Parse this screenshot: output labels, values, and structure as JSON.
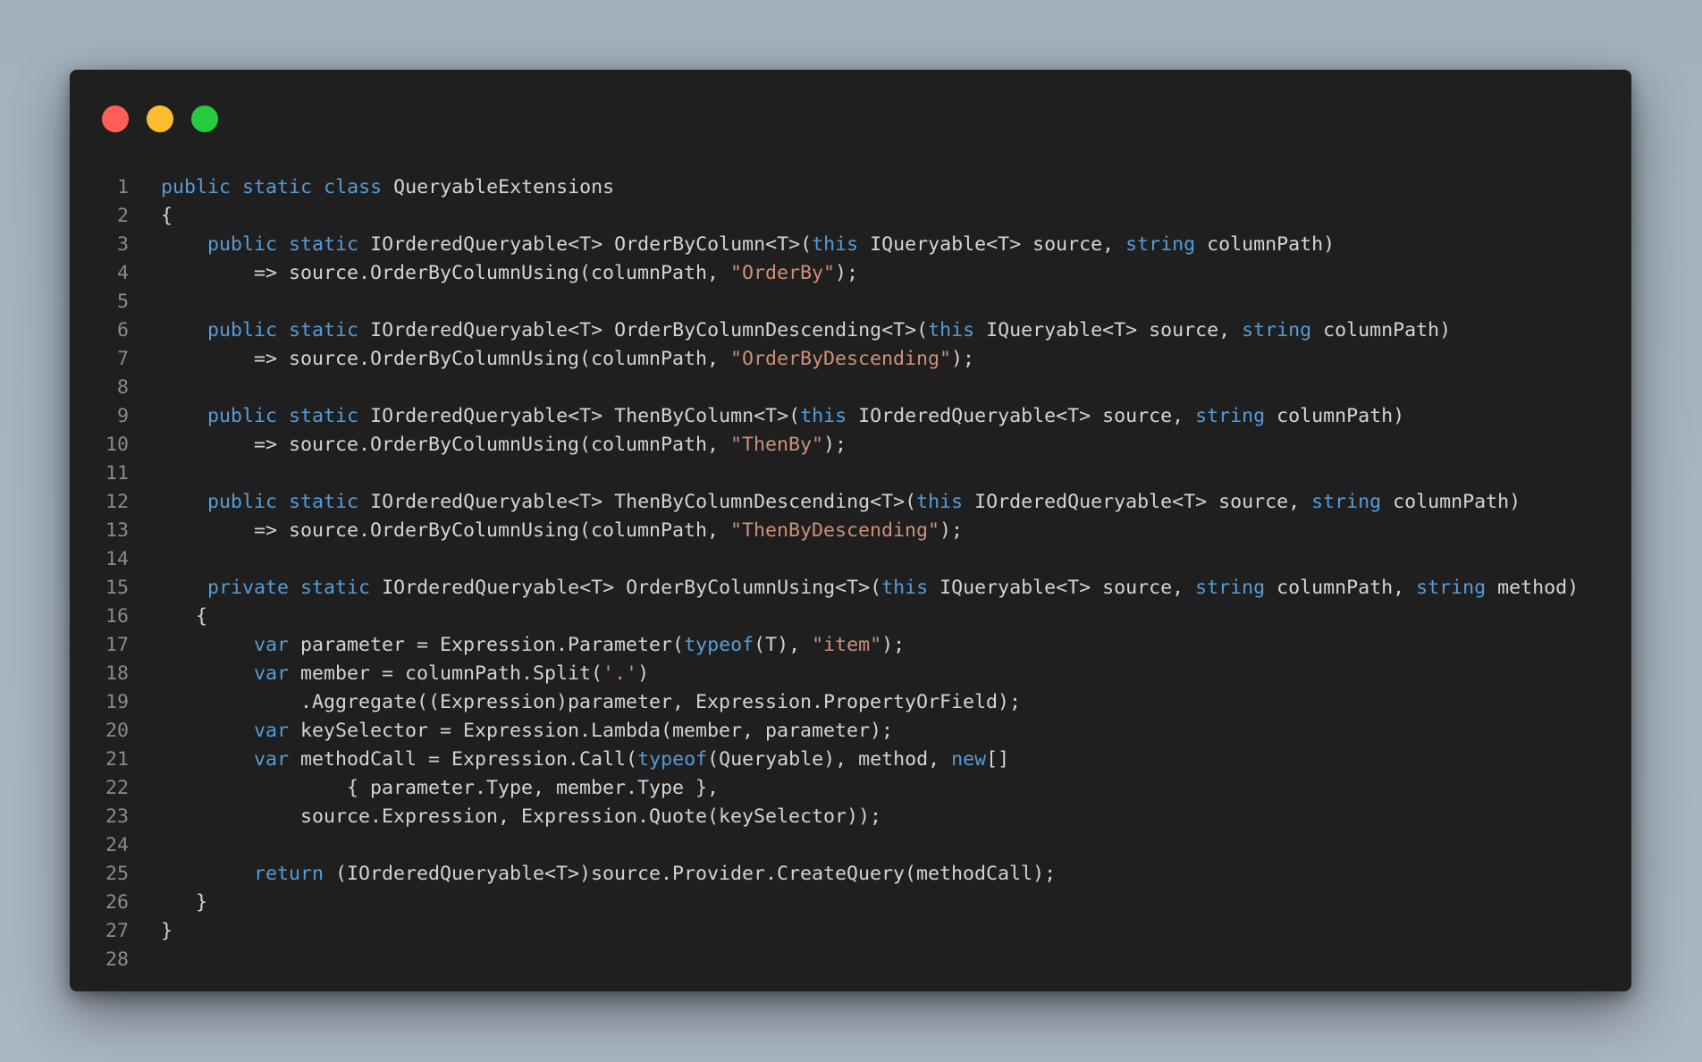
{
  "window": {
    "title_buttons": [
      "close",
      "minimize",
      "maximize"
    ],
    "colors": {
      "background": "#1f1f1f",
      "close": "#ff5f56",
      "minimize": "#ffbd2e",
      "maximize": "#27c93f",
      "keyword": "#569cd6",
      "string": "#ce9178",
      "text": "#d4d4d4",
      "line_number": "#8a8a8a"
    }
  },
  "code": {
    "language": "csharp",
    "lines": [
      {
        "n": "1",
        "tokens": [
          [
            "kw",
            "public"
          ],
          [
            "p",
            " "
          ],
          [
            "kw",
            "static"
          ],
          [
            "p",
            " "
          ],
          [
            "kw",
            "class"
          ],
          [
            "p",
            " QueryableExtensions"
          ]
        ]
      },
      {
        "n": "2",
        "tokens": [
          [
            "p",
            "{"
          ]
        ]
      },
      {
        "n": "3",
        "tokens": [
          [
            "p",
            "    "
          ],
          [
            "kw",
            "public"
          ],
          [
            "p",
            " "
          ],
          [
            "kw",
            "static"
          ],
          [
            "p",
            " IOrderedQueryable<T> OrderByColumn<T>("
          ],
          [
            "kw",
            "this"
          ],
          [
            "p",
            " IQueryable<T> source, "
          ],
          [
            "kw",
            "string"
          ],
          [
            "p",
            " columnPath)"
          ]
        ]
      },
      {
        "n": "4",
        "tokens": [
          [
            "p",
            "        => source.OrderByColumnUsing(columnPath, "
          ],
          [
            "str",
            "\"OrderBy\""
          ],
          [
            "p",
            ");"
          ]
        ]
      },
      {
        "n": "5",
        "tokens": []
      },
      {
        "n": "6",
        "tokens": [
          [
            "p",
            "    "
          ],
          [
            "kw",
            "public"
          ],
          [
            "p",
            " "
          ],
          [
            "kw",
            "static"
          ],
          [
            "p",
            " IOrderedQueryable<T> OrderByColumnDescending<T>("
          ],
          [
            "kw",
            "this"
          ],
          [
            "p",
            " IQueryable<T> source, "
          ],
          [
            "kw",
            "string"
          ],
          [
            "p",
            " columnPath)"
          ]
        ]
      },
      {
        "n": "7",
        "tokens": [
          [
            "p",
            "        => source.OrderByColumnUsing(columnPath, "
          ],
          [
            "str",
            "\"OrderByDescending\""
          ],
          [
            "p",
            ");"
          ]
        ]
      },
      {
        "n": "8",
        "tokens": []
      },
      {
        "n": "9",
        "tokens": [
          [
            "p",
            "    "
          ],
          [
            "kw",
            "public"
          ],
          [
            "p",
            " "
          ],
          [
            "kw",
            "static"
          ],
          [
            "p",
            " IOrderedQueryable<T> ThenByColumn<T>("
          ],
          [
            "kw",
            "this"
          ],
          [
            "p",
            " IOrderedQueryable<T> source, "
          ],
          [
            "kw",
            "string"
          ],
          [
            "p",
            " columnPath)"
          ]
        ]
      },
      {
        "n": "10",
        "tokens": [
          [
            "p",
            "        => source.OrderByColumnUsing(columnPath, "
          ],
          [
            "str",
            "\"ThenBy\""
          ],
          [
            "p",
            ");"
          ]
        ]
      },
      {
        "n": "11",
        "tokens": []
      },
      {
        "n": "12",
        "tokens": [
          [
            "p",
            "    "
          ],
          [
            "kw",
            "public"
          ],
          [
            "p",
            " "
          ],
          [
            "kw",
            "static"
          ],
          [
            "p",
            " IOrderedQueryable<T> ThenByColumnDescending<T>("
          ],
          [
            "kw",
            "this"
          ],
          [
            "p",
            " IOrderedQueryable<T> source, "
          ],
          [
            "kw",
            "string"
          ],
          [
            "p",
            " columnPath)"
          ]
        ]
      },
      {
        "n": "13",
        "tokens": [
          [
            "p",
            "        => source.OrderByColumnUsing(columnPath, "
          ],
          [
            "str",
            "\"ThenByDescending\""
          ],
          [
            "p",
            ");"
          ]
        ]
      },
      {
        "n": "14",
        "tokens": []
      },
      {
        "n": "15",
        "tokens": [
          [
            "p",
            "    "
          ],
          [
            "kw",
            "private"
          ],
          [
            "p",
            " "
          ],
          [
            "kw",
            "static"
          ],
          [
            "p",
            " IOrderedQueryable<T> OrderByColumnUsing<T>("
          ],
          [
            "kw",
            "this"
          ],
          [
            "p",
            " IQueryable<T> source, "
          ],
          [
            "kw",
            "string"
          ],
          [
            "p",
            " columnPath, "
          ],
          [
            "kw",
            "string"
          ],
          [
            "p",
            " method)"
          ]
        ]
      },
      {
        "n": "16",
        "tokens": [
          [
            "p",
            "   {"
          ]
        ]
      },
      {
        "n": "17",
        "tokens": [
          [
            "p",
            "        "
          ],
          [
            "kw",
            "var"
          ],
          [
            "p",
            " parameter = Expression.Parameter("
          ],
          [
            "kw",
            "typeof"
          ],
          [
            "p",
            "(T), "
          ],
          [
            "str",
            "\"item\""
          ],
          [
            "p",
            ");"
          ]
        ]
      },
      {
        "n": "18",
        "tokens": [
          [
            "p",
            "        "
          ],
          [
            "kw",
            "var"
          ],
          [
            "p",
            " member = columnPath.Split("
          ],
          [
            "str",
            "'.'"
          ],
          [
            "p",
            ")"
          ]
        ]
      },
      {
        "n": "19",
        "tokens": [
          [
            "p",
            "            .Aggregate((Expression)parameter, Expression.PropertyOrField);"
          ]
        ]
      },
      {
        "n": "20",
        "tokens": [
          [
            "p",
            "        "
          ],
          [
            "kw",
            "var"
          ],
          [
            "p",
            " keySelector = Expression.Lambda(member, parameter);"
          ]
        ]
      },
      {
        "n": "21",
        "tokens": [
          [
            "p",
            "        "
          ],
          [
            "kw",
            "var"
          ],
          [
            "p",
            " methodCall = Expression.Call("
          ],
          [
            "kw",
            "typeof"
          ],
          [
            "p",
            "(Queryable), method, "
          ],
          [
            "kw",
            "new"
          ],
          [
            "p",
            "[]"
          ]
        ]
      },
      {
        "n": "22",
        "tokens": [
          [
            "p",
            "                { parameter.Type, member.Type },"
          ]
        ]
      },
      {
        "n": "23",
        "tokens": [
          [
            "p",
            "            source.Expression, Expression.Quote(keySelector));"
          ]
        ]
      },
      {
        "n": "24",
        "tokens": []
      },
      {
        "n": "25",
        "tokens": [
          [
            "p",
            "        "
          ],
          [
            "kw",
            "return"
          ],
          [
            "p",
            " (IOrderedQueryable<T>)source.Provider.CreateQuery(methodCall);"
          ]
        ]
      },
      {
        "n": "26",
        "tokens": [
          [
            "p",
            "   }"
          ]
        ]
      },
      {
        "n": "27",
        "tokens": [
          [
            "p",
            "}"
          ]
        ]
      },
      {
        "n": "28",
        "tokens": []
      }
    ]
  }
}
